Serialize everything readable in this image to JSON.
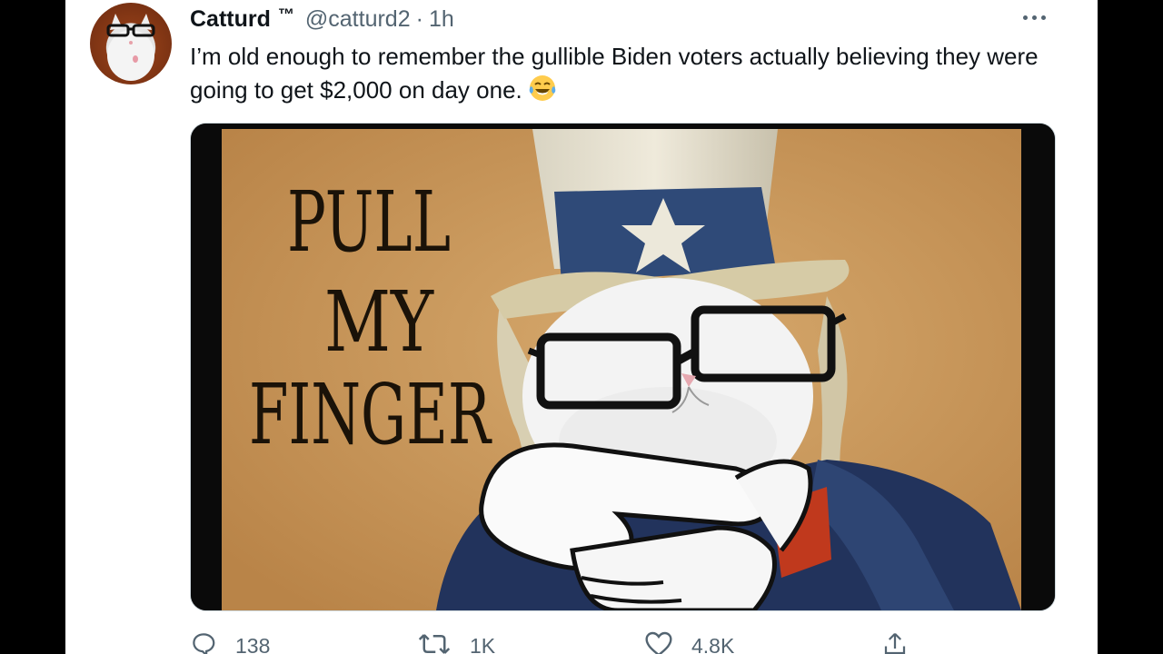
{
  "tweet": {
    "display_name": "Catturd",
    "trademark": "™",
    "handle": "@catturd2",
    "separator": "·",
    "time": "1h",
    "text": "I’m old enough to remember the gullible Biden voters actually believing they were going to get $2,000 on day one.",
    "emoji": "face-with-tears-of-joy",
    "more_icon": "more-horizontal-icon"
  },
  "media": {
    "poster_text": [
      "PULL",
      "MY",
      "FINGER"
    ],
    "colors": {
      "background": "#c9985c",
      "letterbox": "#0a0a0a",
      "hat_band": "#2f4a78",
      "jacket": "#22335c",
      "bowtie": "#c0391d"
    }
  },
  "actions": {
    "reply": {
      "icon": "reply-icon",
      "count": "138"
    },
    "retweet": {
      "icon": "retweet-icon",
      "count": "1K"
    },
    "like": {
      "icon": "heart-icon",
      "count": "4.8K"
    },
    "share": {
      "icon": "share-icon",
      "count": ""
    }
  }
}
